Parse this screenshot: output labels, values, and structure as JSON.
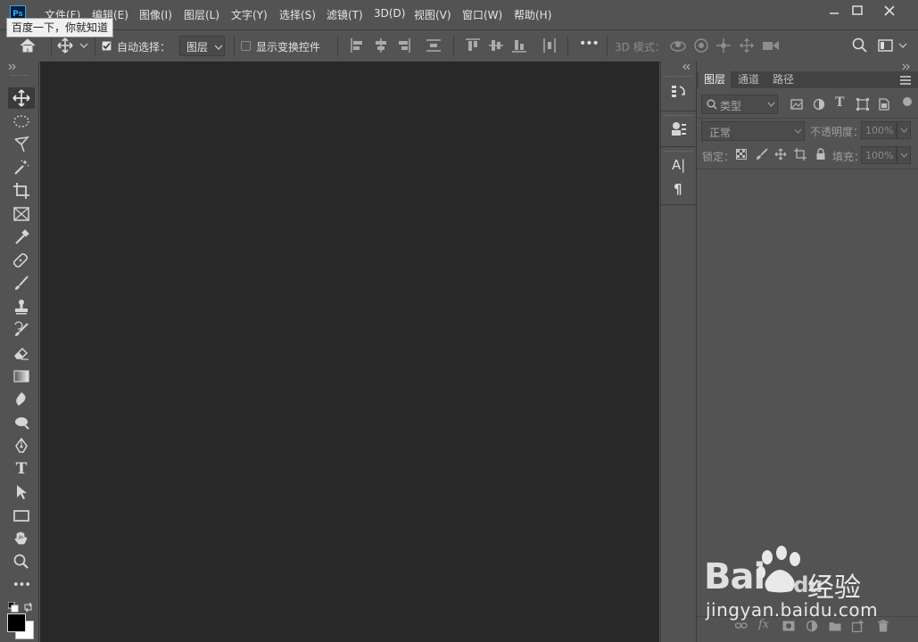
{
  "app": {
    "logo": "Ps",
    "tooltip": "百度一下，你就知道"
  },
  "menu": [
    "文件(F)",
    "编辑(E)",
    "图像(I)",
    "图层(L)",
    "文字(Y)",
    "选择(S)",
    "滤镜(T)",
    "3D(D)",
    "视图(V)",
    "窗口(W)",
    "帮助(H)"
  ],
  "options": {
    "auto_select_label": "自动选择：",
    "auto_select_checked": true,
    "auto_select_target": "图层",
    "show_transform_label": "显示变换控件",
    "show_transform_checked": false,
    "more": "•••",
    "mode_3d_label": "3D 模式："
  },
  "toolbar": {
    "tools": [
      "move-tool",
      "marquee-tool",
      "lasso-tool",
      "magic-wand-tool",
      "crop-tool",
      "frame-tool",
      "eyedropper-tool",
      "healing-brush-tool",
      "brush-tool",
      "clone-stamp-tool",
      "history-brush-tool",
      "eraser-tool",
      "gradient-tool",
      "blur-tool",
      "dodge-tool",
      "pen-tool",
      "type-tool",
      "path-selection-tool",
      "rectangle-tool",
      "hand-tool",
      "zoom-tool",
      "edit-toolbar"
    ],
    "type_glyph": "T",
    "more_glyph": "•••"
  },
  "dock": {
    "character_glyph": "A|",
    "paragraph_glyph": "¶"
  },
  "layers_panel": {
    "tabs": [
      "图层",
      "通道",
      "路径"
    ],
    "active_tab": "图层",
    "filter_placeholder": "类型",
    "blend_mode": "正常",
    "opacity_label": "不透明度：",
    "opacity_value": "100%",
    "lock_label": "锁定：",
    "fill_label": "填充：",
    "fill_value": "100%",
    "filter_type_glyph": "T"
  },
  "watermark": {
    "brand": "Bai",
    "brand2": "du",
    "cn": "经验",
    "url": "jingyan.baidu.com"
  },
  "colors": {
    "accent": "#31a8ff",
    "canvas": "#282828",
    "panel": "#535353"
  }
}
